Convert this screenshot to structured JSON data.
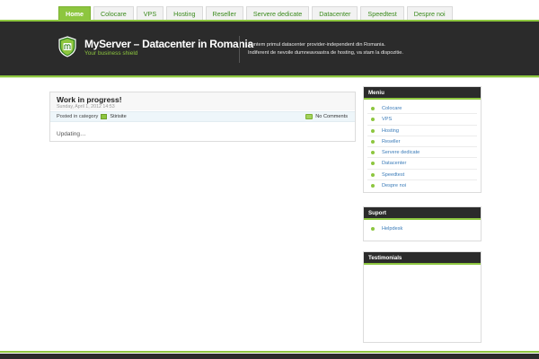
{
  "nav": {
    "items": [
      {
        "label": "Home",
        "active": true
      },
      {
        "label": "Colocare"
      },
      {
        "label": "VPS"
      },
      {
        "label": "Hosting"
      },
      {
        "label": "Reseller"
      },
      {
        "label": "Servere dedicate"
      },
      {
        "label": "Datacenter"
      },
      {
        "label": "Speedtest"
      },
      {
        "label": "Despre noi"
      }
    ]
  },
  "header": {
    "logo_icon": "shield-icon",
    "title": "MyServer – Datacenter in Romania",
    "tagline": "Your business shield",
    "description_line1": "Suntem primul datacenter provider-independent din Romania.",
    "description_line2": "Indiferent de nevoile dumneavoastra de hosting, va stam la dispozitie."
  },
  "post": {
    "title": "Work in progress!",
    "date": "Sunday, April 1, 2012 14:53",
    "posted_in_label": "Posted in category",
    "category_icon": "folder-icon",
    "category": "Stirisite",
    "comment_icon": "comment-icon",
    "comments": "No Comments",
    "body": "Updating…"
  },
  "sidebar": {
    "menu": {
      "title": "Meniu",
      "items": [
        "Colocare",
        "VPS",
        "Hosting",
        "Reseller",
        "Servere dedicate",
        "Datacenter",
        "Speedtest",
        "Despre noi"
      ]
    },
    "support": {
      "title": "Suport",
      "items": [
        "Helpdesk"
      ]
    },
    "testimonials": {
      "title": "Testimonials"
    }
  },
  "colors": {
    "accent_green": "#8dc63f",
    "header_dark": "#2b2b2b",
    "link_blue": "#3a7bb8"
  }
}
